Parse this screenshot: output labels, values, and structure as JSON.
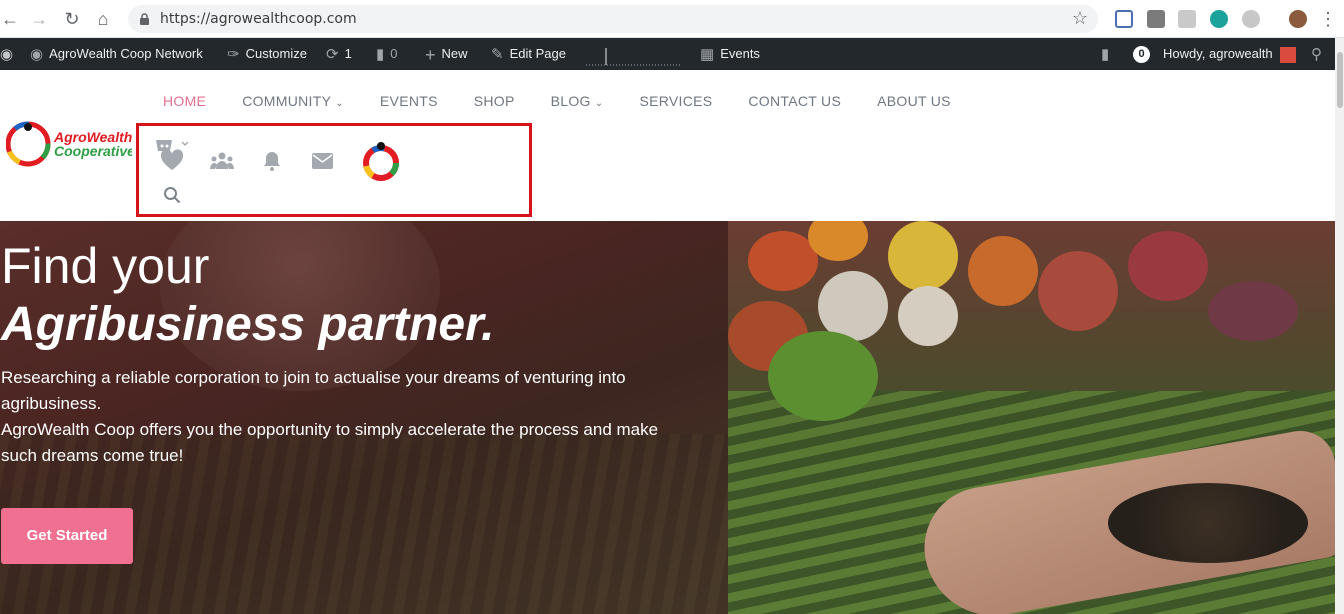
{
  "browser": {
    "url": "https://agrowealthcoop.com"
  },
  "adminbar": {
    "network": "AgroWealth Coop Network",
    "customize": "Customize",
    "updates_count": "1",
    "comments_count": "0",
    "new": "New",
    "edit_page": "Edit Page",
    "events": "Events",
    "notifications_count": "0",
    "howdy": "Howdy, agrowealth"
  },
  "nav": {
    "items": [
      {
        "label": "HOME",
        "active": true,
        "dropdown": false
      },
      {
        "label": "COMMUNITY",
        "active": false,
        "dropdown": true
      },
      {
        "label": "EVENTS",
        "active": false,
        "dropdown": false
      },
      {
        "label": "SHOP",
        "active": false,
        "dropdown": false
      },
      {
        "label": "BLOG",
        "active": false,
        "dropdown": true
      },
      {
        "label": "SERVICES",
        "active": false,
        "dropdown": false
      },
      {
        "label": "CONTACT US",
        "active": false,
        "dropdown": false
      },
      {
        "label": "ABOUT US",
        "active": false,
        "dropdown": false
      }
    ]
  },
  "logo": {
    "line1": "AgroWealth",
    "line2": "Cooperative"
  },
  "header_icons": [
    "cart-icon",
    "heart-icon",
    "groups-icon",
    "bell-icon",
    "envelope-icon",
    "profile-avatar",
    "search-icon"
  ],
  "hero": {
    "title_line1": "Find your",
    "title_line2": "Agribusiness partner.",
    "text_line1": "Researching a reliable corporation to join to actualise your dreams of venturing into agribusiness.",
    "text_line2": "AgroWealth Coop offers you the opportunity to simply accelerate the process and make such dreams come true!",
    "cta": "Get Started"
  },
  "colors": {
    "accent": "#e2718f",
    "cta": "#ef7091",
    "adminbar": "#23282d",
    "highlight": "#d6121a"
  }
}
